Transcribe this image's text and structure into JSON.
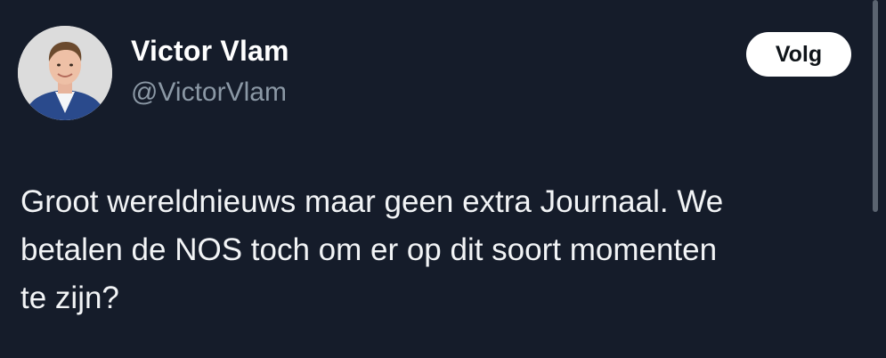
{
  "tweet": {
    "author": {
      "display_name": "Victor Vlam",
      "handle": "@VictorVlam",
      "avatar_icon": "person-portrait-avatar"
    },
    "follow_label": "Volg",
    "text_lines": [
      "Groot wereldnieuws maar geen extra Journaal. We",
      "betalen de NOS toch om er op dit soort momenten",
      "te zijn?"
    ]
  },
  "colors": {
    "background": "#151c2a",
    "text": "#f2f4f6",
    "handle": "#8b98a5",
    "button_bg": "#ffffff",
    "button_text": "#0f1419"
  }
}
